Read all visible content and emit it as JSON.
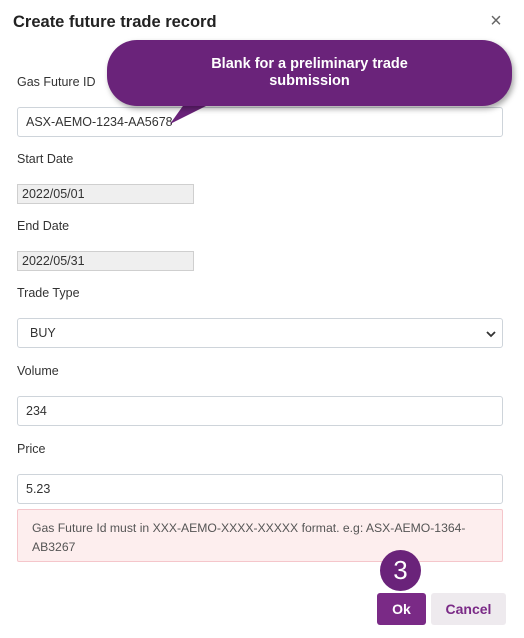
{
  "dialog": {
    "title": "Create future trade record",
    "close_symbol": "×"
  },
  "tooltip": {
    "text_line1": "Blank for a preliminary trade",
    "text_line2": "submission"
  },
  "form": {
    "gas_future_id": {
      "label": "Gas Future ID",
      "value": "ASX-AEMO-1234-AA5678"
    },
    "start_date": {
      "label": "Start Date",
      "value": "2022/05/01"
    },
    "end_date": {
      "label": "End Date",
      "value": "2022/05/31"
    },
    "trade_type": {
      "label": "Trade Type",
      "value": "BUY"
    },
    "volume": {
      "label": "Volume",
      "value": "234"
    },
    "price": {
      "label": "Price",
      "value": "5.23"
    }
  },
  "alert": {
    "line1": "Gas Future Id must in XXX-AEMO-XXXX-XXXXX format. e.g: ASX-AEMO-1364-",
    "line2": "AB3267"
  },
  "step_badge": "3",
  "buttons": {
    "ok_label": "Ok",
    "cancel_label": "Cancel"
  },
  "colors": {
    "accent": "#7a2a86",
    "tooltip": "#6a237a",
    "alert_bg": "#fdeeee",
    "alert_border": "#f5c6cb"
  }
}
